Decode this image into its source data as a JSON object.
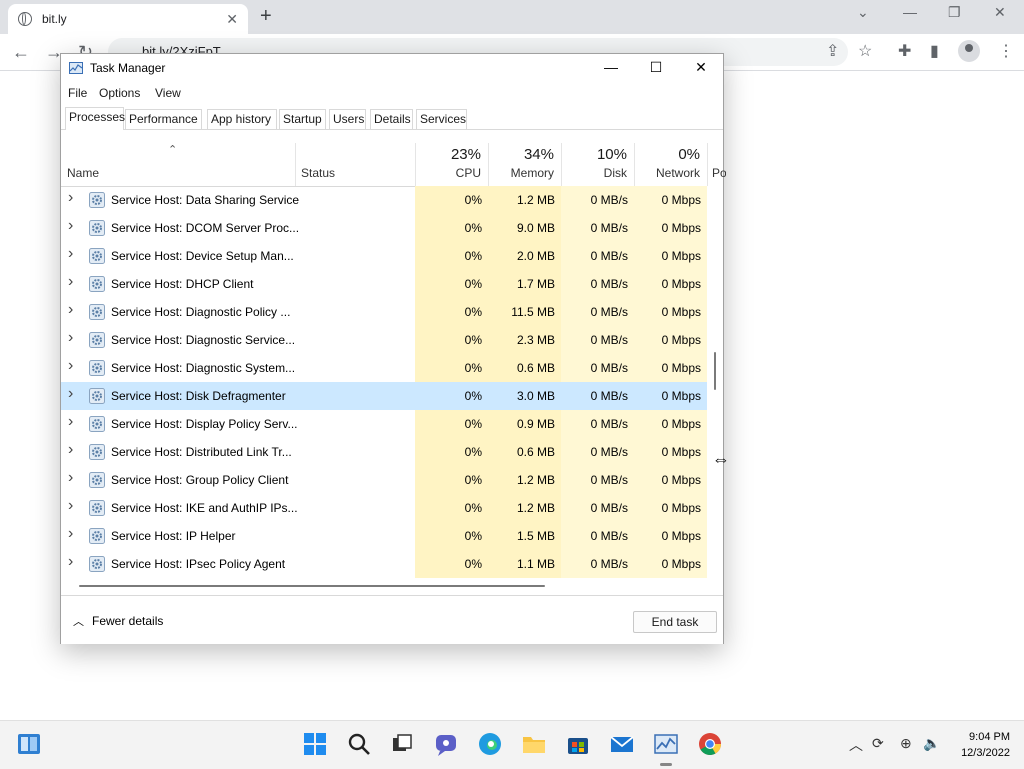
{
  "browser": {
    "tab_title": "bit.ly",
    "tab_close": "✕",
    "new_tab": "+",
    "url": "bit.ly/2XziFpT"
  },
  "task_manager": {
    "title": "Task Manager",
    "menu": [
      "File",
      "Options",
      "View"
    ],
    "tabs": [
      "Processes",
      "Performance",
      "App history",
      "Startup",
      "Users",
      "Details",
      "Services"
    ],
    "active_tab": "Processes",
    "columns": {
      "name": "Name",
      "status": "Status",
      "cpu_pct": "23%",
      "cpu": "CPU",
      "memory_pct": "34%",
      "memory": "Memory",
      "disk_pct": "10%",
      "disk": "Disk",
      "network_pct": "0%",
      "network": "Network",
      "power_partial": "Po"
    },
    "rows": [
      {
        "name": "Service Host: Data Sharing Service",
        "cpu": "0%",
        "memory": "1.2 MB",
        "disk": "0 MB/s",
        "network": "0 Mbps"
      },
      {
        "name": "Service Host: DCOM Server Proc...",
        "cpu": "0%",
        "memory": "9.0 MB",
        "disk": "0 MB/s",
        "network": "0 Mbps"
      },
      {
        "name": "Service Host: Device Setup Man...",
        "cpu": "0%",
        "memory": "2.0 MB",
        "disk": "0 MB/s",
        "network": "0 Mbps"
      },
      {
        "name": "Service Host: DHCP Client",
        "cpu": "0%",
        "memory": "1.7 MB",
        "disk": "0 MB/s",
        "network": "0 Mbps"
      },
      {
        "name": "Service Host: Diagnostic Policy ...",
        "cpu": "0%",
        "memory": "11.5 MB",
        "disk": "0 MB/s",
        "network": "0 Mbps"
      },
      {
        "name": "Service Host: Diagnostic Service...",
        "cpu": "0%",
        "memory": "2.3 MB",
        "disk": "0 MB/s",
        "network": "0 Mbps"
      },
      {
        "name": "Service Host: Diagnostic System...",
        "cpu": "0%",
        "memory": "0.6 MB",
        "disk": "0 MB/s",
        "network": "0 Mbps"
      },
      {
        "name": "Service Host: Disk Defragmenter",
        "cpu": "0%",
        "memory": "3.0 MB",
        "disk": "0 MB/s",
        "network": "0 Mbps"
      },
      {
        "name": "Service Host: Display Policy Serv...",
        "cpu": "0%",
        "memory": "0.9 MB",
        "disk": "0 MB/s",
        "network": "0 Mbps"
      },
      {
        "name": "Service Host: Distributed Link Tr...",
        "cpu": "0%",
        "memory": "0.6 MB",
        "disk": "0 MB/s",
        "network": "0 Mbps"
      },
      {
        "name": "Service Host: Group Policy Client",
        "cpu": "0%",
        "memory": "1.2 MB",
        "disk": "0 MB/s",
        "network": "0 Mbps"
      },
      {
        "name": "Service Host: IKE and AuthIP IPs...",
        "cpu": "0%",
        "memory": "1.2 MB",
        "disk": "0 MB/s",
        "network": "0 Mbps"
      },
      {
        "name": "Service Host: IP Helper",
        "cpu": "0%",
        "memory": "1.5 MB",
        "disk": "0 MB/s",
        "network": "0 Mbps"
      },
      {
        "name": "Service Host: IPsec Policy Agent",
        "cpu": "0%",
        "memory": "1.1 MB",
        "disk": "0 MB/s",
        "network": "0 Mbps"
      }
    ],
    "selected_row_index": 7,
    "fewer_details": "Fewer details",
    "end_task": "End task"
  },
  "taskbar": {
    "time": "9:04 PM",
    "date": "12/3/2022"
  },
  "colors": {
    "highlight_cell": "#fff4c4",
    "selected_row": "#cce8ff",
    "browser_frame": "#dfe1e5",
    "taskbar_bg": "#f3f3f3"
  }
}
